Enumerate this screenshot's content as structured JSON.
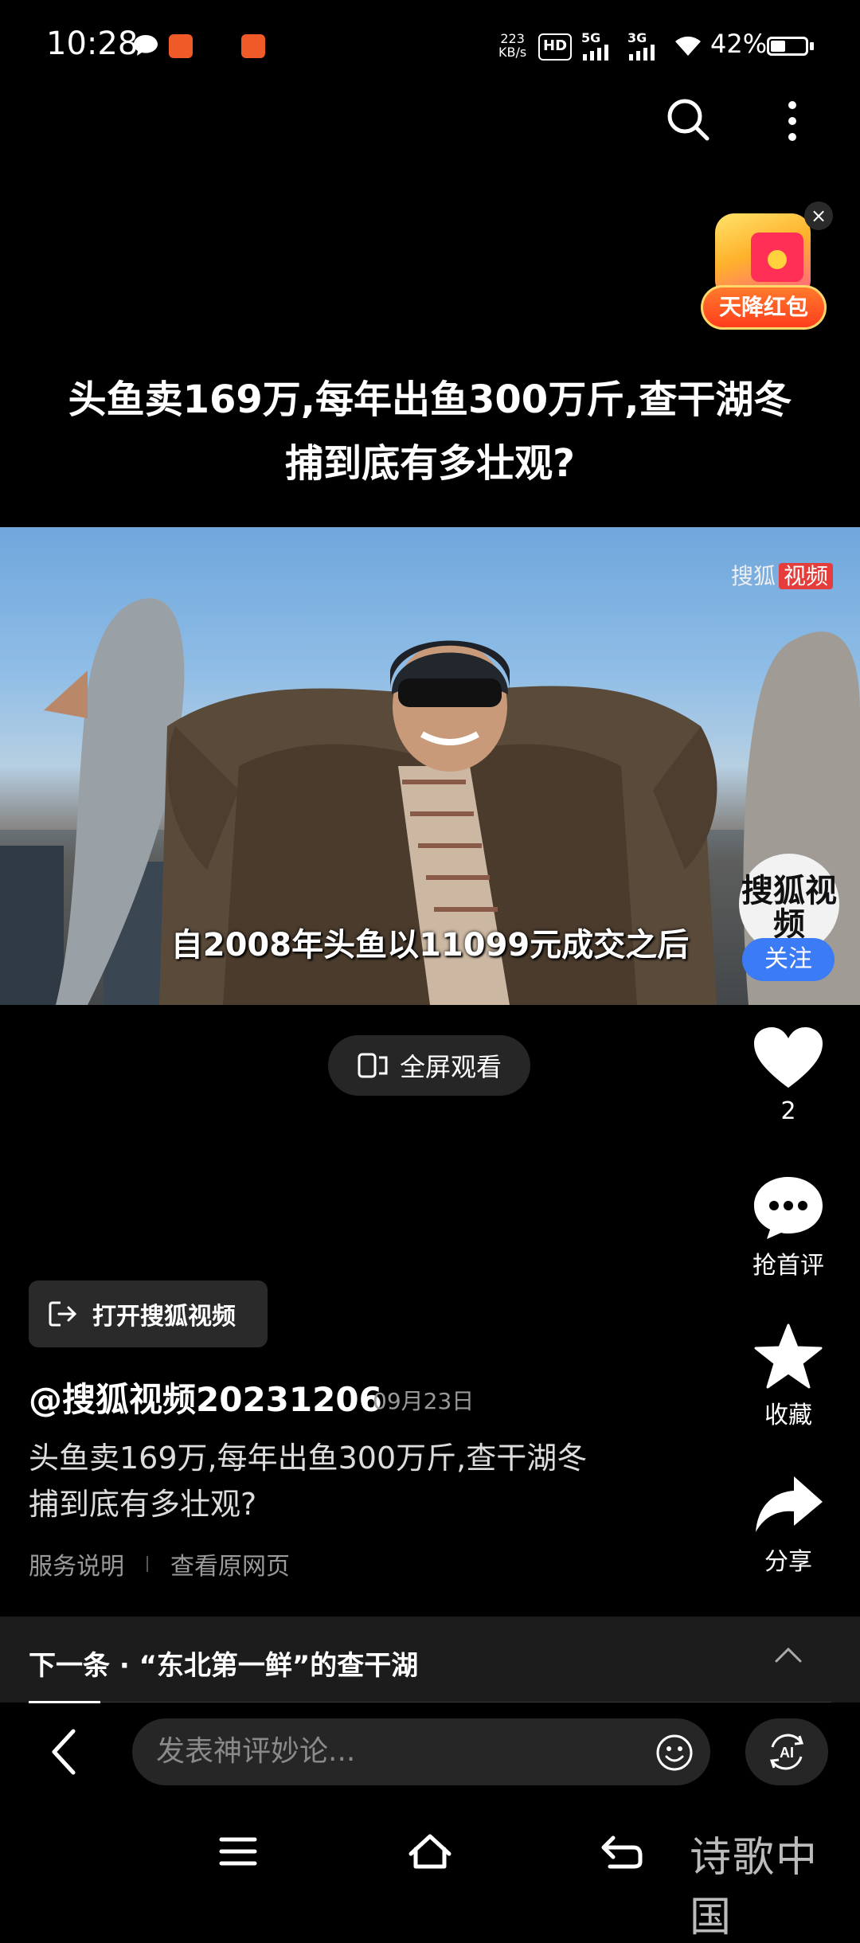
{
  "status_bar": {
    "time": "10:28",
    "net_speed_value": "223",
    "net_speed_unit": "KB/s",
    "hd_label": "HD",
    "sim1_label": "5G",
    "sim2_label": "3G",
    "battery_percent": "42%",
    "battery_level": 0.42
  },
  "red_packet": {
    "label": "天降红包",
    "close": "×"
  },
  "headline": "头鱼卖169万,每年出鱼300万斤,查干湖冬捕到底有多壮观?",
  "video": {
    "watermark_brand": "搜狐",
    "watermark_tag": "视频",
    "subtitle": "自2008年头鱼以11099元成交之后",
    "channel_logo_text": "搜狐视频",
    "follow_label": "关注"
  },
  "fullscreen_label": "全屏观看",
  "actions": {
    "like_count": "2",
    "comment_label": "抢首评",
    "favorite_label": "收藏",
    "share_label": "分享"
  },
  "open_app_label": "打开搜狐视频",
  "author": "@搜狐视频20231206",
  "date": "09月23日",
  "description_line1": "头鱼卖169万,每年出鱼300万斤,查干湖冬",
  "description_line2": "捕到底有多壮观?",
  "links": {
    "service": "服务说明",
    "original": "查看原网页"
  },
  "next_item": "下一条 · “东北第一鲜”的查干湖",
  "comment_placeholder": "发表神评妙论...",
  "signature": "诗歌中国",
  "colors": {
    "follow": "#3b7bf6",
    "background": "#000000",
    "surface": "#262626"
  }
}
